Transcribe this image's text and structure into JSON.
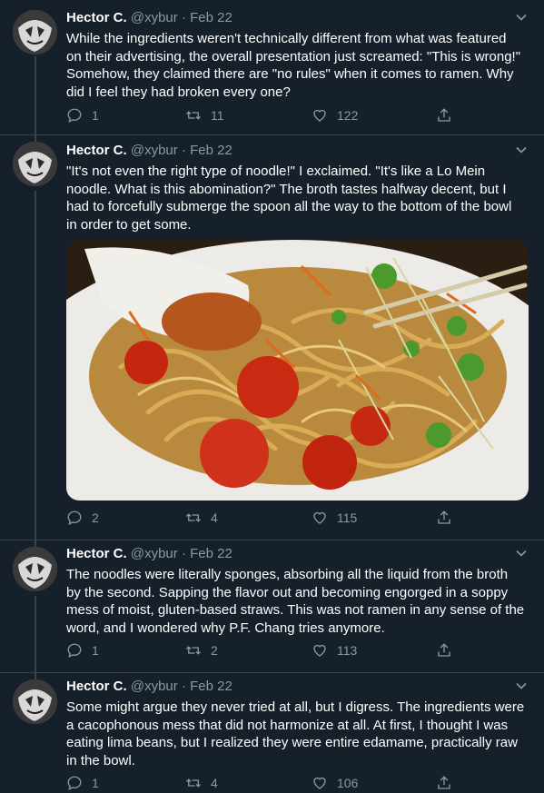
{
  "tweets": [
    {
      "name": "Hector C.",
      "handle": "@xybur",
      "date": "Feb 22",
      "text": "While the ingredients weren't technically different from what was featured on their advertising, the overall presentation just screamed: \"This is wrong!\" Somehow, they claimed there are \"no rules\" when it comes to ramen. Why did I feel they had broken every one?",
      "replies": "1",
      "retweets": "11",
      "likes": "122"
    },
    {
      "name": "Hector C.",
      "handle": "@xybur",
      "date": "Feb 22",
      "text": "\"It's not even the right type of noodle!\" I exclaimed. \"It's like a Lo Mein noodle. What is this abomination?\" The broth tastes halfway decent, but I had to forcefully submerge the spoon all the way to the bottom of the bowl in order to get some.",
      "replies": "2",
      "retweets": "4",
      "likes": "115"
    },
    {
      "name": "Hector C.",
      "handle": "@xybur",
      "date": "Feb 22",
      "text": "The noodles were literally sponges, absorbing all the liquid from the broth by the second. Sapping the flavor out and becoming engorged in a soppy mess of moist, gluten-based straws. This was not ramen in any sense of the word, and I wondered why P.F. Chang tries anymore.",
      "replies": "1",
      "retweets": "2",
      "likes": "113"
    },
    {
      "name": "Hector C.",
      "handle": "@xybur",
      "date": "Feb 22",
      "text": "Some might argue they never tried at all, but I digress. The ingredients were a cacophonous mess that did not harmonize at all. At first, I thought I was eating lima beans, but I realized they were entire edamame, practically raw in the bowl.",
      "replies": "1",
      "retweets": "4",
      "likes": "106"
    }
  ],
  "separator": "·",
  "colors": {
    "background": "#15202b",
    "text": "#ffffff",
    "secondary": "#8899a6",
    "border": "#38444d"
  },
  "icons": {
    "reply": "reply-icon",
    "retweet": "retweet-icon",
    "like": "like-icon",
    "share": "share-icon",
    "caret": "chevron-down-icon"
  }
}
